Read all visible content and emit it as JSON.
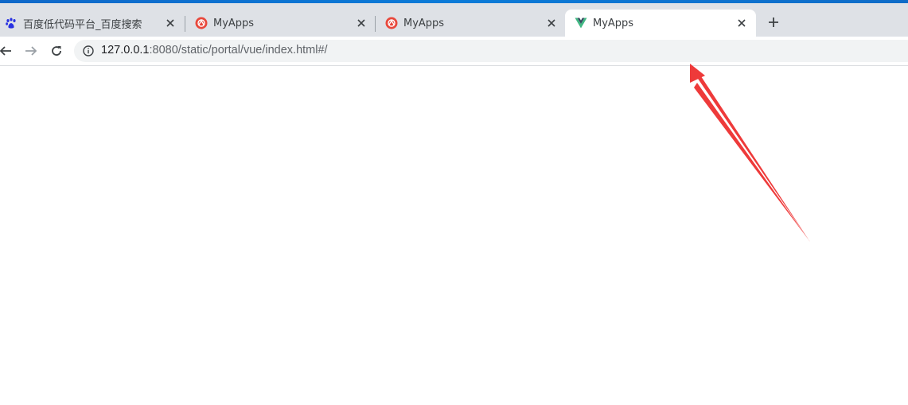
{
  "browser": {
    "tabs": [
      {
        "title": "百度低代码平台_百度搜索",
        "favicon": "baidu-paw-icon",
        "active": false
      },
      {
        "title": "MyApps",
        "favicon": "myapps-icon",
        "active": false
      },
      {
        "title": "MyApps",
        "favicon": "myapps-icon",
        "active": false
      },
      {
        "title": "MyApps",
        "favicon": "vue-icon",
        "active": true
      }
    ],
    "new_tab_icon": "plus-icon",
    "address_bar": {
      "host": "127.0.0.1",
      "rest": ":8080/static/portal/vue/index.html#/",
      "info_icon": "info-icon"
    },
    "nav_icons": [
      "back-arrow-icon",
      "forward-arrow-icon",
      "reload-icon"
    ]
  },
  "colors": {
    "top_strip": "#0b7bd8",
    "tab_bar": "#dee1e6",
    "omnibox": "#f1f3f4",
    "annotation_arrow": "#ee3a3a",
    "myapps_favicon": "#e8483c",
    "vue_green": "#41b883",
    "vue_dark": "#35495e",
    "baidu_blue": "#2932e1"
  },
  "annotation": {
    "type": "red-arrow",
    "points_to": "address-bar-right-end"
  }
}
